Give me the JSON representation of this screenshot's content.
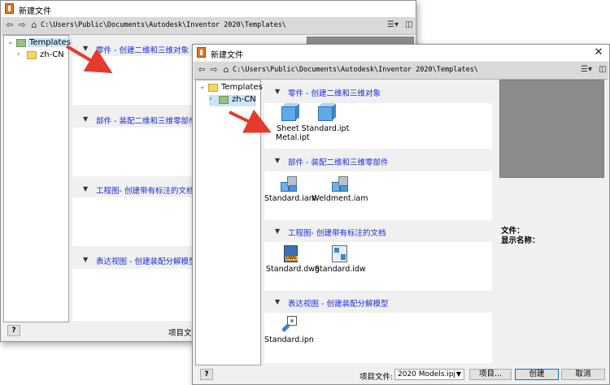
{
  "dialog_title": "新建文件",
  "path": "C:\\Users\\Public\\Documents\\Autodesk\\Inventor 2020\\Templates\\",
  "tree": {
    "root": "Templates",
    "child": "zh-CN"
  },
  "sections": [
    {
      "label": "零件 - 创建二维和三维对象",
      "files": [
        "Sheet Metal.ipt",
        "Standard.ipt"
      ]
    },
    {
      "label": "部件 - 装配二维和三维零部件",
      "files": [
        "Standard.iam",
        "Weldment.iam"
      ]
    },
    {
      "label": "工程图- 创建带有标注的文档",
      "files": [
        "Standard.dwg",
        "Standard.idw"
      ]
    },
    {
      "label": "表达视图 - 创建装配分解模型",
      "files": [
        "Standard.ipn"
      ]
    }
  ],
  "back_sections": [
    "零件 - 创建二维和三维对象",
    "部件 - 装配二维和三维零部件",
    "工程图- 创建带有标注的文档",
    "表达视图 - 创建装配分解模型"
  ],
  "info": {
    "file_label": "文件：",
    "display_name_label": "显示名称："
  },
  "footer": {
    "help": "?",
    "project_label": "项目文件:",
    "project_value": "2020 Models.ipj",
    "project_btn": "项目...",
    "create_btn": "创建",
    "cancel_btn": "取消",
    "back_project_label": "项目文件"
  },
  "icons": {
    "back": "back-arrow-icon",
    "forward": "forward-arrow-icon",
    "home": "home-icon",
    "view": "view-options-icon",
    "panel": "panel-toggle-icon",
    "close": "close-icon"
  },
  "colors": {
    "section_label": "#1a2edb",
    "arrow": "#e53a2c",
    "preview": "#8c8c8c"
  }
}
